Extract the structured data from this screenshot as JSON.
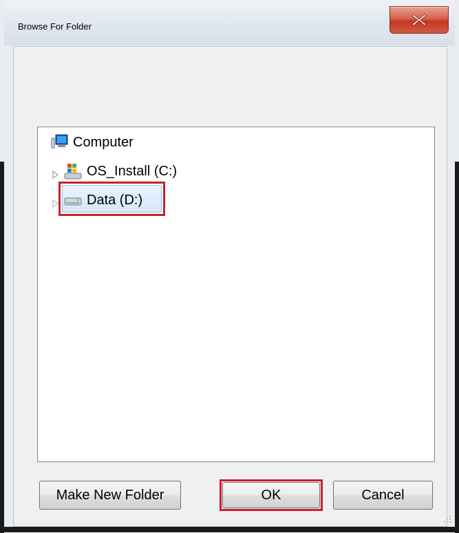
{
  "window": {
    "title": "Browse For Folder"
  },
  "tree": {
    "items": [
      {
        "label": "Computer",
        "icon": "computer-icon"
      },
      {
        "label": "OS_Install (C:)",
        "icon": "windows-drive-icon"
      },
      {
        "label": "Data (D:)",
        "icon": "drive-icon",
        "selected": true
      }
    ]
  },
  "buttons": {
    "make_new_folder": "Make New Folder",
    "ok": "OK",
    "cancel": "Cancel"
  },
  "colors": {
    "highlight_outline": "#c8202a",
    "close_button": "#c0391f"
  }
}
